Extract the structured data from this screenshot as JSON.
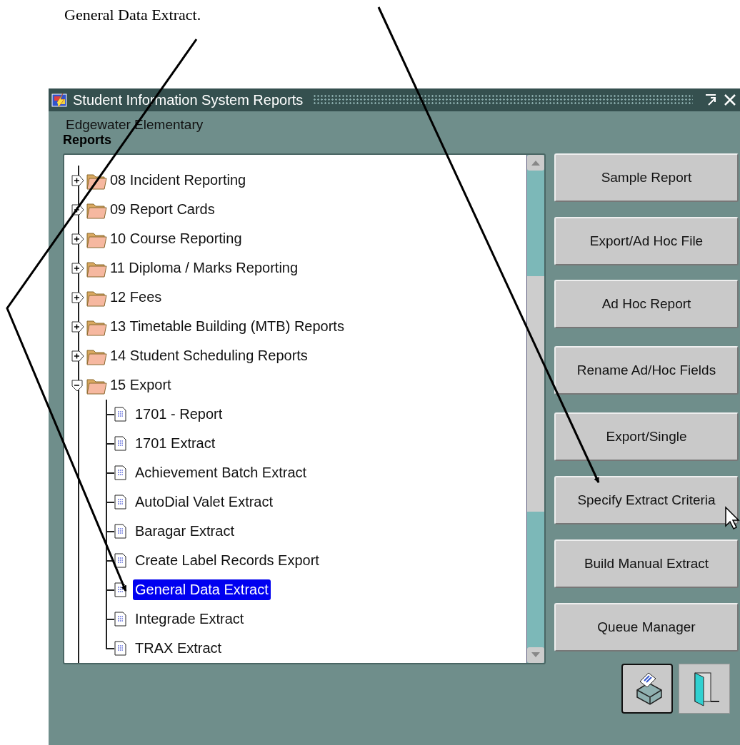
{
  "document_text": "General Data Extract.",
  "window": {
    "title": "Student Information System Reports"
  },
  "school": "Edgewater Elementary",
  "heading": "Reports",
  "tree": [
    {
      "label": "08 Incident Reporting",
      "expanded": false,
      "selected": false
    },
    {
      "label": "09 Report Cards",
      "expanded": false,
      "selected": false
    },
    {
      "label": "10 Course Reporting",
      "expanded": false,
      "selected": false
    },
    {
      "label": "11 Diploma / Marks Reporting",
      "expanded": false,
      "selected": false
    },
    {
      "label": "12 Fees",
      "expanded": false,
      "selected": false
    },
    {
      "label": "13 Timetable Building (MTB) Reports",
      "expanded": false,
      "selected": false
    },
    {
      "label": "14 Student Scheduling Reports",
      "expanded": false,
      "selected": false
    },
    {
      "label": "15 Export",
      "expanded": true,
      "selected": false,
      "children": [
        {
          "label": "1701 - Report",
          "selected": false
        },
        {
          "label": "1701 Extract",
          "selected": false
        },
        {
          "label": "Achievement Batch Extract",
          "selected": false
        },
        {
          "label": "AutoDial Valet Extract",
          "selected": false
        },
        {
          "label": "Baragar Extract",
          "selected": false
        },
        {
          "label": "Create Label Records Export",
          "selected": false
        },
        {
          "label": "General Data Extract",
          "selected": true
        },
        {
          "label": "Integrade Extract",
          "selected": false
        },
        {
          "label": "TRAX Extract",
          "selected": false
        }
      ]
    }
  ],
  "buttons": [
    "Sample Report",
    "Export/Ad Hoc File",
    "Ad Hoc Report",
    "Rename Ad/Hoc Fields",
    "Export/Single",
    "Specify Extract Criteria",
    "Build Manual Extract",
    "Queue Manager"
  ]
}
